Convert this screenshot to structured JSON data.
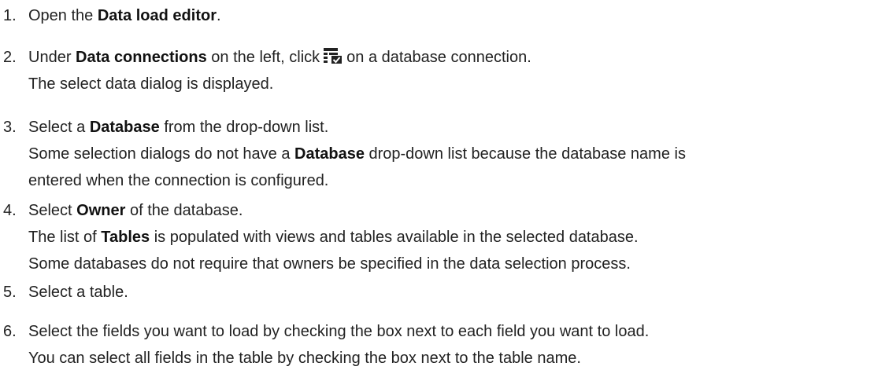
{
  "steps": [
    {
      "number": "1.",
      "segments": [
        {
          "text": "Open the "
        },
        {
          "text": "Data load editor",
          "bold": true
        },
        {
          "text": "."
        }
      ]
    },
    {
      "number": "2.",
      "segments_before_icon": [
        {
          "text": "Under "
        },
        {
          "text": "Data connections",
          "bold": true
        },
        {
          "text": " on the left, click"
        }
      ],
      "icon": "select-data-icon",
      "after_icon": "on a database connection.",
      "result": "The select data dialog is displayed."
    },
    {
      "number": "3.",
      "segments": [
        {
          "text": "Select a "
        },
        {
          "text": "Database",
          "bold": true
        },
        {
          "text": " from the drop-down list."
        }
      ],
      "note_line1": [
        {
          "text": "Some selection dialogs do not have a "
        },
        {
          "text": "Database",
          "bold": true
        },
        {
          "text": " drop-down list because the database name is"
        }
      ],
      "note_line2": "entered when the connection is configured."
    },
    {
      "number": "4.",
      "segments": [
        {
          "text": "Select "
        },
        {
          "text": "Owner",
          "bold": true
        },
        {
          "text": " of the database."
        }
      ],
      "note_line1": [
        {
          "text": "The list of "
        },
        {
          "text": "Tables",
          "bold": true
        },
        {
          "text": " is populated with views and tables available in the selected database."
        }
      ],
      "note_line2": "Some databases do not require that owners be specified in the data selection process."
    },
    {
      "number": "5.",
      "text": "Select a table."
    },
    {
      "number": "6.",
      "text": "Select the fields you want to load by checking the box next to each field you want to load.",
      "note": "You can select all fields in the table by checking the box next to the table name."
    }
  ]
}
